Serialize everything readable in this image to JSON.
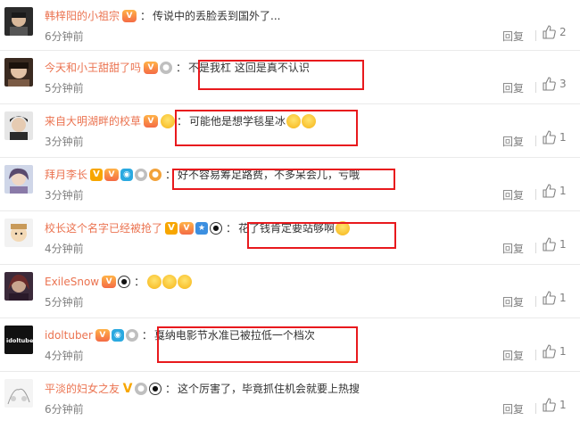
{
  "comments": [
    {
      "username": "韩梓阳的小祖宗",
      "badges": [
        "vip-icon"
      ],
      "text": "传说中的丢脸丢到国外了...",
      "emojis": 0,
      "time": "6分钟前",
      "reply_label": "回复",
      "likes": "2"
    },
    {
      "username": "今天和小王甜甜了吗",
      "badges": [
        "vip-icon",
        "medal-icon"
      ],
      "text": "不是我杠 这回是真不认识",
      "emojis": 0,
      "time": "5分钟前",
      "reply_label": "回复",
      "likes": "3"
    },
    {
      "username": "来自大明湖畔的校草",
      "badges": [
        "vip-icon",
        "sunglasses-emoji-icon"
      ],
      "text": "可能他是想学毯星冰",
      "emojis": 2,
      "time": "3分钟前",
      "reply_label": "回复",
      "likes": "1"
    },
    {
      "username": "拜月李长",
      "badges": [
        "verified-v-icon",
        "vip-icon",
        "camera-icon",
        "medal-icon",
        "gold-medal-icon"
      ],
      "text": "好不容易筹足路费，不多呆会儿，亏哦",
      "emojis": 0,
      "time": "3分钟前",
      "reply_label": "回复",
      "likes": "1"
    },
    {
      "username": "校长这个名字已经被抢了",
      "badges": [
        "verified-v-icon",
        "vip-icon",
        "star-icon",
        "panda-icon"
      ],
      "text": "花了钱肯定要站够啊",
      "emojis": 1,
      "time": "4分钟前",
      "reply_label": "回复",
      "likes": "1"
    },
    {
      "username": "ExileSnow",
      "badges": [
        "vip-icon",
        "panda-icon"
      ],
      "text": "",
      "emojis": 3,
      "time": "5分钟前",
      "reply_label": "回复",
      "likes": "1"
    },
    {
      "username": "idoltuber",
      "badges": [
        "vip-icon",
        "camera-icon",
        "medal-icon"
      ],
      "text": "戛纳电影节水准已被拉低一个档次",
      "emojis": 0,
      "time": "4分钟前",
      "reply_label": "回复",
      "likes": "1"
    },
    {
      "username": "平淡的妇女之友",
      "badges": [
        "yellow-v-icon",
        "medal-icon",
        "panda-icon"
      ],
      "text": "这个厉害了，毕竟抓住机会就要上热搜",
      "emojis": 0,
      "time": "6分钟前",
      "reply_label": "回复",
      "likes": "1"
    }
  ],
  "avatar_text_idoltuber": "idoltube",
  "colors": {
    "username": "#eb7350",
    "muted": "#808080",
    "highlight": "#e8191d"
  }
}
